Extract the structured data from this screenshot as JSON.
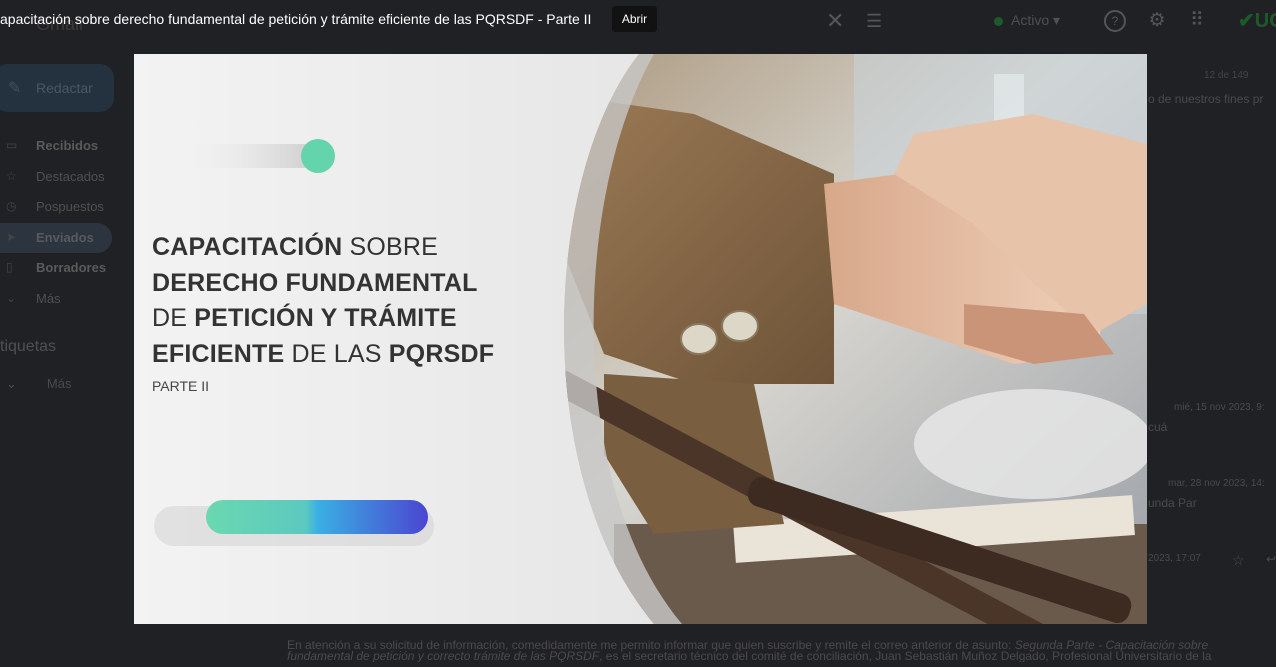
{
  "viewer": {
    "title": "apacitación sobre derecho fundamental de petición y trámite eficiente de las PQRSDF - Parte II",
    "open_label": "Abrir"
  },
  "gmail": {
    "app_name": "Gmail",
    "compose_label": "Redactar",
    "status_label": "Activo",
    "logo_text": "UC",
    "nav": [
      {
        "label": "Recibidos",
        "icon": "inbox-icon"
      },
      {
        "label": "Destacados",
        "icon": "star-icon"
      },
      {
        "label": "Pospuestos",
        "icon": "clock-icon"
      },
      {
        "label": "Enviados",
        "icon": "send-icon"
      },
      {
        "label": "Borradores",
        "icon": "draft-icon"
      },
      {
        "label": "Más",
        "icon": "chevron-down-icon"
      }
    ],
    "labels_heading": "tiquetas",
    "labels_more": "Más",
    "message_count": "12 de 149",
    "snippets": [
      "o de nuestros fines pr",
      "mié, 15 nov 2023, 9:",
      "cuá",
      "mar, 28 nov 2023, 14:",
      "unda Par",
      "2023, 17:07"
    ],
    "body_line_1_a": "En atención a su solicitud de información, comedidamente me permito informar que quien suscribe y remite el correo anterior de asunto: ",
    "body_line_1_b": "Segunda Parte - Capacitación sobre",
    "body_line_2_a": "fundamental de petición y correcto trámite de las PQRSDF",
    "body_line_2_b": ", es el secretario técnico del comité de conciliación, Juan Sebastián Muñoz Delgado, Profesional Universitario de la"
  },
  "slide": {
    "title_lines": [
      {
        "bold": "CAPACITACIÓN",
        "rest": " SOBRE"
      },
      {
        "bold": "DERECHO FUNDAMENTAL",
        "rest": ""
      },
      {
        "pre": "DE ",
        "bold": "PETICIÓN",
        "rest": " Y TRÁMITE"
      },
      {
        "bold": "EFICIENTE",
        "rest": " DE LAS ",
        "bold2": "PQRSDF"
      }
    ],
    "subtitle": "PARTE II"
  },
  "colors": {
    "accent_teal": "#5fd4a8",
    "accent_blue": "#3b86e6",
    "accent_indigo": "#4a4ad6",
    "jacket": "#8a6a4a",
    "backdrop": "#202124"
  }
}
